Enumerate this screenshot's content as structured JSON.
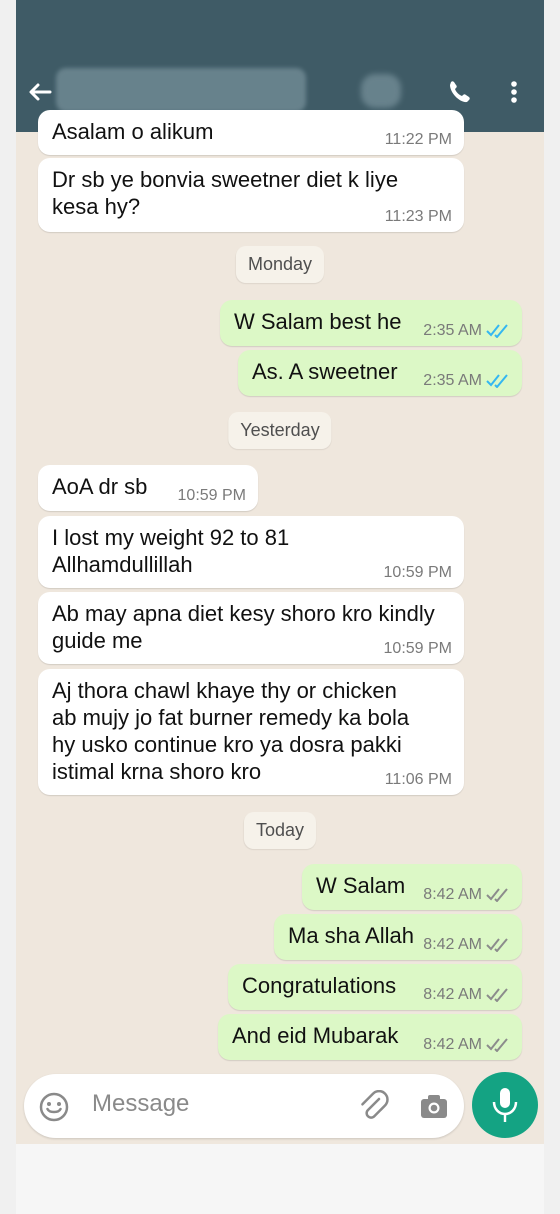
{
  "header": {
    "icons": [
      "back-arrow-icon",
      "phone-icon",
      "more-vert-icon"
    ]
  },
  "chat": {
    "messages": [
      {
        "dir": "in",
        "text": "Asalam o alikum",
        "time": "11:22 PM"
      },
      {
        "dir": "in",
        "text": "Dr sb ye bonvia sweetner diet k liye\nkesa hy?",
        "time": "11:23 PM"
      },
      {
        "dir": "date",
        "text": "Monday"
      },
      {
        "dir": "out",
        "text": "W Salam best he",
        "time": "2:35 AM",
        "ticks": "read"
      },
      {
        "dir": "out",
        "text": "As. A sweetner",
        "time": "2:35 AM",
        "ticks": "read"
      },
      {
        "dir": "date",
        "text": "Yesterday"
      },
      {
        "dir": "in",
        "text": "AoA dr sb",
        "time": "10:59 PM"
      },
      {
        "dir": "in",
        "text": "I lost my weight 92 to 81\nAllhamdullillah",
        "time": "10:59 PM"
      },
      {
        "dir": "in",
        "text": "Ab may apna diet kesy shoro kro kindly\nguide me",
        "time": "10:59 PM"
      },
      {
        "dir": "in",
        "text": "Aj thora chawl khaye thy or chicken\nab mujy jo fat burner remedy ka bola\nhy usko continue kro ya dosra pakki\nistimal krna shoro kro",
        "time": "11:06 PM"
      },
      {
        "dir": "date",
        "text": "Today"
      },
      {
        "dir": "out",
        "text": "W Salam",
        "time": "8:42 AM",
        "ticks": "delivered"
      },
      {
        "dir": "out",
        "text": "Ma sha Allah",
        "time": "8:42 AM",
        "ticks": "delivered"
      },
      {
        "dir": "out",
        "text": "Congratulations",
        "time": "8:42 AM",
        "ticks": "delivered"
      },
      {
        "dir": "out",
        "text": "And eid Mubarak",
        "time": "8:42 AM",
        "ticks": "delivered"
      }
    ]
  },
  "composer": {
    "placeholder": "Message",
    "icons": [
      "emoji-icon",
      "attach-icon",
      "camera-icon",
      "mic-icon"
    ]
  },
  "colors": {
    "header": "#3f5b66",
    "chat_bg": "#efe7dd",
    "incoming": "#ffffff",
    "outgoing": "#dcf8c6",
    "read_tick": "#34b7f1",
    "delivered_tick": "#8c8c8c",
    "mic_button": "#14a383"
  }
}
